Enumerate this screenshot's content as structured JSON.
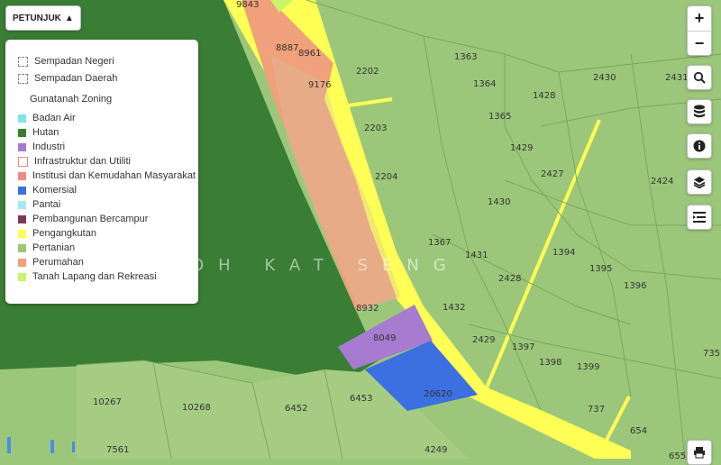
{
  "legend_toggle": {
    "label": "PETUNJUK",
    "icon": "caret-up-icon"
  },
  "legend": {
    "boundaries": [
      {
        "label": "Sempadan Negeri"
      },
      {
        "label": "Sempadan Daerah"
      }
    ],
    "zoning_title": "Gunatanah Zoning",
    "zoning": [
      {
        "label": "Badan Air",
        "color": "#7fe3f0"
      },
      {
        "label": "Hutan",
        "color": "#3a7d34"
      },
      {
        "label": "Industri",
        "color": "#a77bd0"
      },
      {
        "label": "Infrastruktur dan Utiliti",
        "color": "#ffffff"
      },
      {
        "label": "Institusi dan Kemudahan Masyarakat",
        "color": "#f08a8a"
      },
      {
        "label": "Komersial",
        "color": "#3c6fe0"
      },
      {
        "label": "Pantai",
        "color": "#a9e4f5"
      },
      {
        "label": "Pembangunan Bercampur",
        "color": "#7a3b5a"
      },
      {
        "label": "Pengangkutan",
        "color": "#ffff55"
      },
      {
        "label": "Pertanian",
        "color": "#9cc77a"
      },
      {
        "label": "Perumahan",
        "color": "#f0a07a"
      },
      {
        "label": "Tanah Lapang dan Rekreasi",
        "color": "#c9f56a"
      }
    ]
  },
  "map": {
    "place_name": "TOH KAT SENG",
    "lots": [
      "1363",
      "2202",
      "2430",
      "2431",
      "1364",
      "1428",
      "1365",
      "2203",
      "1429",
      "2427",
      "2204",
      "2424",
      "1430",
      "1367",
      "1431",
      "1394",
      "1395",
      "2428",
      "1396",
      "1432",
      "2429",
      "1397",
      "1398",
      "1399",
      "735",
      "8049",
      "20620",
      "737",
      "654",
      "10267",
      "10268",
      "6452",
      "6453",
      "7561",
      "4249",
      "655",
      "8887",
      "8961",
      "9176",
      "8932",
      "9843"
    ]
  },
  "controls": {
    "zoom_in": "+",
    "zoom_out": "−",
    "search": "search-icon",
    "data": "database-icon",
    "info": "info-icon",
    "layers": "layers-icon",
    "list": "list-icon",
    "print": "print-icon"
  }
}
